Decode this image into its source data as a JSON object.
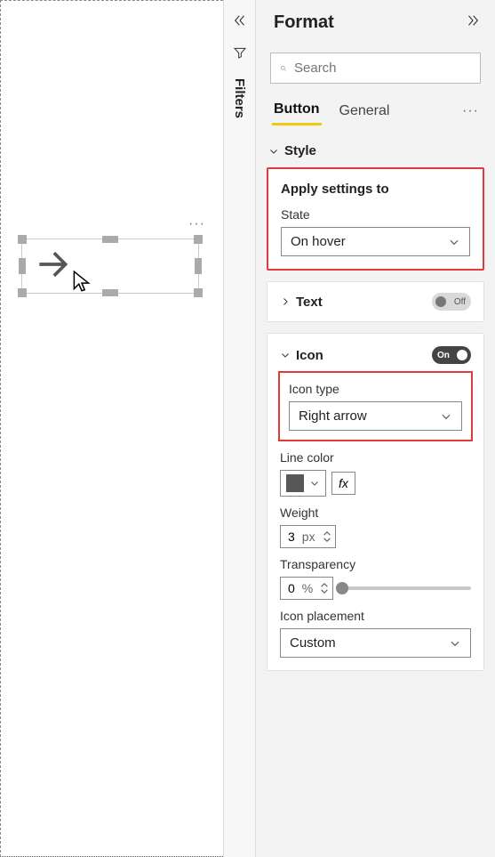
{
  "filters": {
    "label": "Filters"
  },
  "pane": {
    "title": "Format",
    "search_placeholder": "Search",
    "tabs": {
      "button": "Button",
      "general": "General"
    },
    "style": {
      "header": "Style",
      "apply_title": "Apply settings to",
      "state_label": "State",
      "state_value": "On hover"
    },
    "text": {
      "label": "Text",
      "toggle": "Off"
    },
    "icon": {
      "label": "Icon",
      "toggle": "On",
      "type_label": "Icon type",
      "type_value": "Right arrow",
      "line_color_label": "Line color",
      "line_color_value": "#585858",
      "fx": "fx",
      "weight_label": "Weight",
      "weight_value": "3",
      "weight_unit": "px",
      "transparency_label": "Transparency",
      "transparency_value": "0",
      "transparency_unit": "%",
      "placement_label": "Icon placement",
      "placement_value": "Custom"
    }
  }
}
